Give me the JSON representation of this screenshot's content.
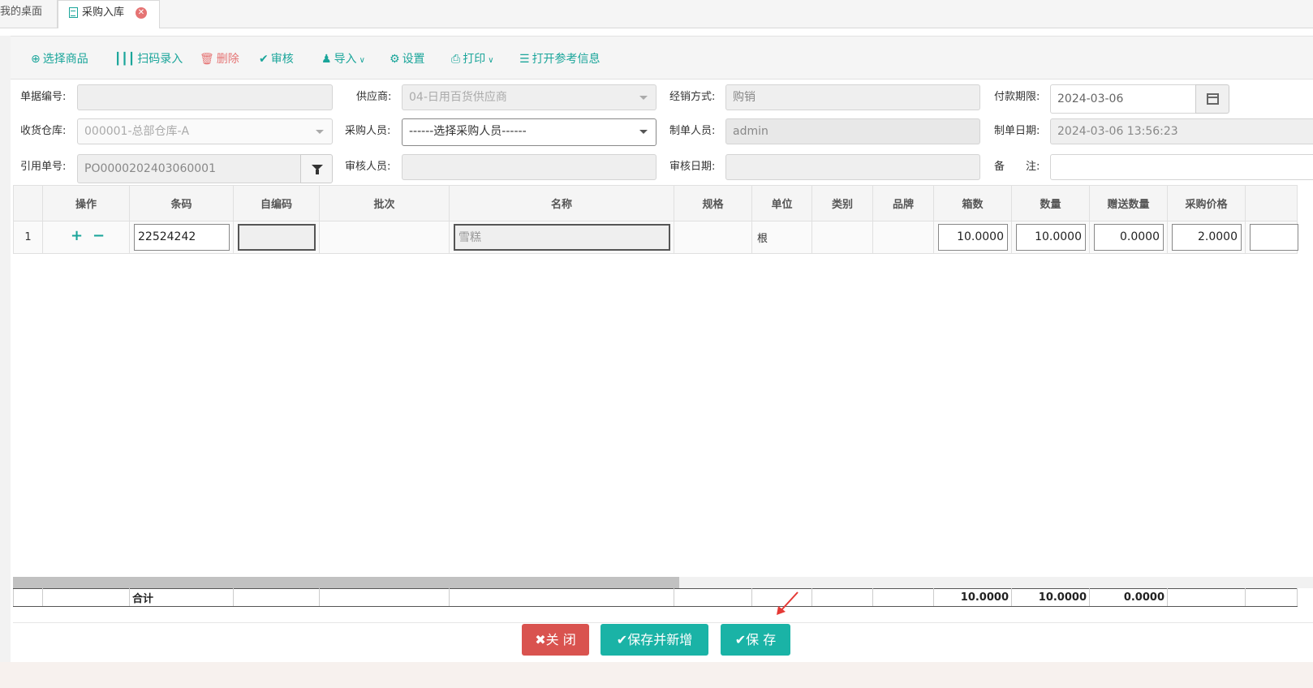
{
  "tabs": [
    {
      "label": "我的桌面"
    },
    {
      "label": "采购入库"
    }
  ],
  "toolbar": {
    "select_goods": "选择商品",
    "scan_entry": "扫码录入",
    "delete": "删除",
    "audit": "审核",
    "import": "导入",
    "settings": "设置",
    "print": "打印",
    "open_reference": "打开参考信息"
  },
  "form": {
    "doc_no": {
      "label": "单据编号:",
      "value": ""
    },
    "supplier": {
      "label": "供应商:",
      "value": "04-日用百货供应商"
    },
    "sales_mode": {
      "label": "经销方式:",
      "value": "购销"
    },
    "payment_term": {
      "label": "付款期限:",
      "value": "2024-03-06"
    },
    "warehouse": {
      "label": "收货仓库:",
      "value": "000001-总部仓库-A"
    },
    "purchaser": {
      "label": "采购人员:",
      "value": "------选择采购人员------"
    },
    "creator": {
      "label": "制单人员:",
      "value": "admin"
    },
    "create_date": {
      "label": "制单日期:",
      "value": "2024-03-06 13:56:23"
    },
    "ref_no": {
      "label": "引用单号:",
      "value": "PO0000202403060001"
    },
    "auditor": {
      "label": "审核人员:",
      "value": ""
    },
    "audit_date": {
      "label": "审核日期:",
      "value": ""
    },
    "remark": {
      "label": "备　　注:",
      "value": ""
    }
  },
  "grid": {
    "headers": [
      "",
      "操作",
      "条码",
      "自编码",
      "批次",
      "名称",
      "规格",
      "单位",
      "类别",
      "品牌",
      "箱数",
      "数量",
      "赠送数量",
      "采购价格",
      ""
    ],
    "rows": [
      {
        "index": "1",
        "add": "+",
        "remove": "−",
        "barcode": "22524242",
        "self_code": "",
        "batch": "",
        "name": "雪糕",
        "spec": "",
        "unit": "根",
        "category": "",
        "brand": "",
        "boxes": "10.0000",
        "quantity": "10.0000",
        "gift_qty": "0.0000",
        "price": "2.0000"
      }
    ],
    "totals": {
      "label": "合计",
      "boxes": "10.0000",
      "quantity": "10.0000",
      "gift_qty": "0.0000"
    }
  },
  "buttons": {
    "close": "✖关 闭",
    "save_new": "✔保存并新增",
    "save": "✔保 存"
  },
  "colors": {
    "accent": "#1ab3a6",
    "danger": "#d9534f"
  }
}
